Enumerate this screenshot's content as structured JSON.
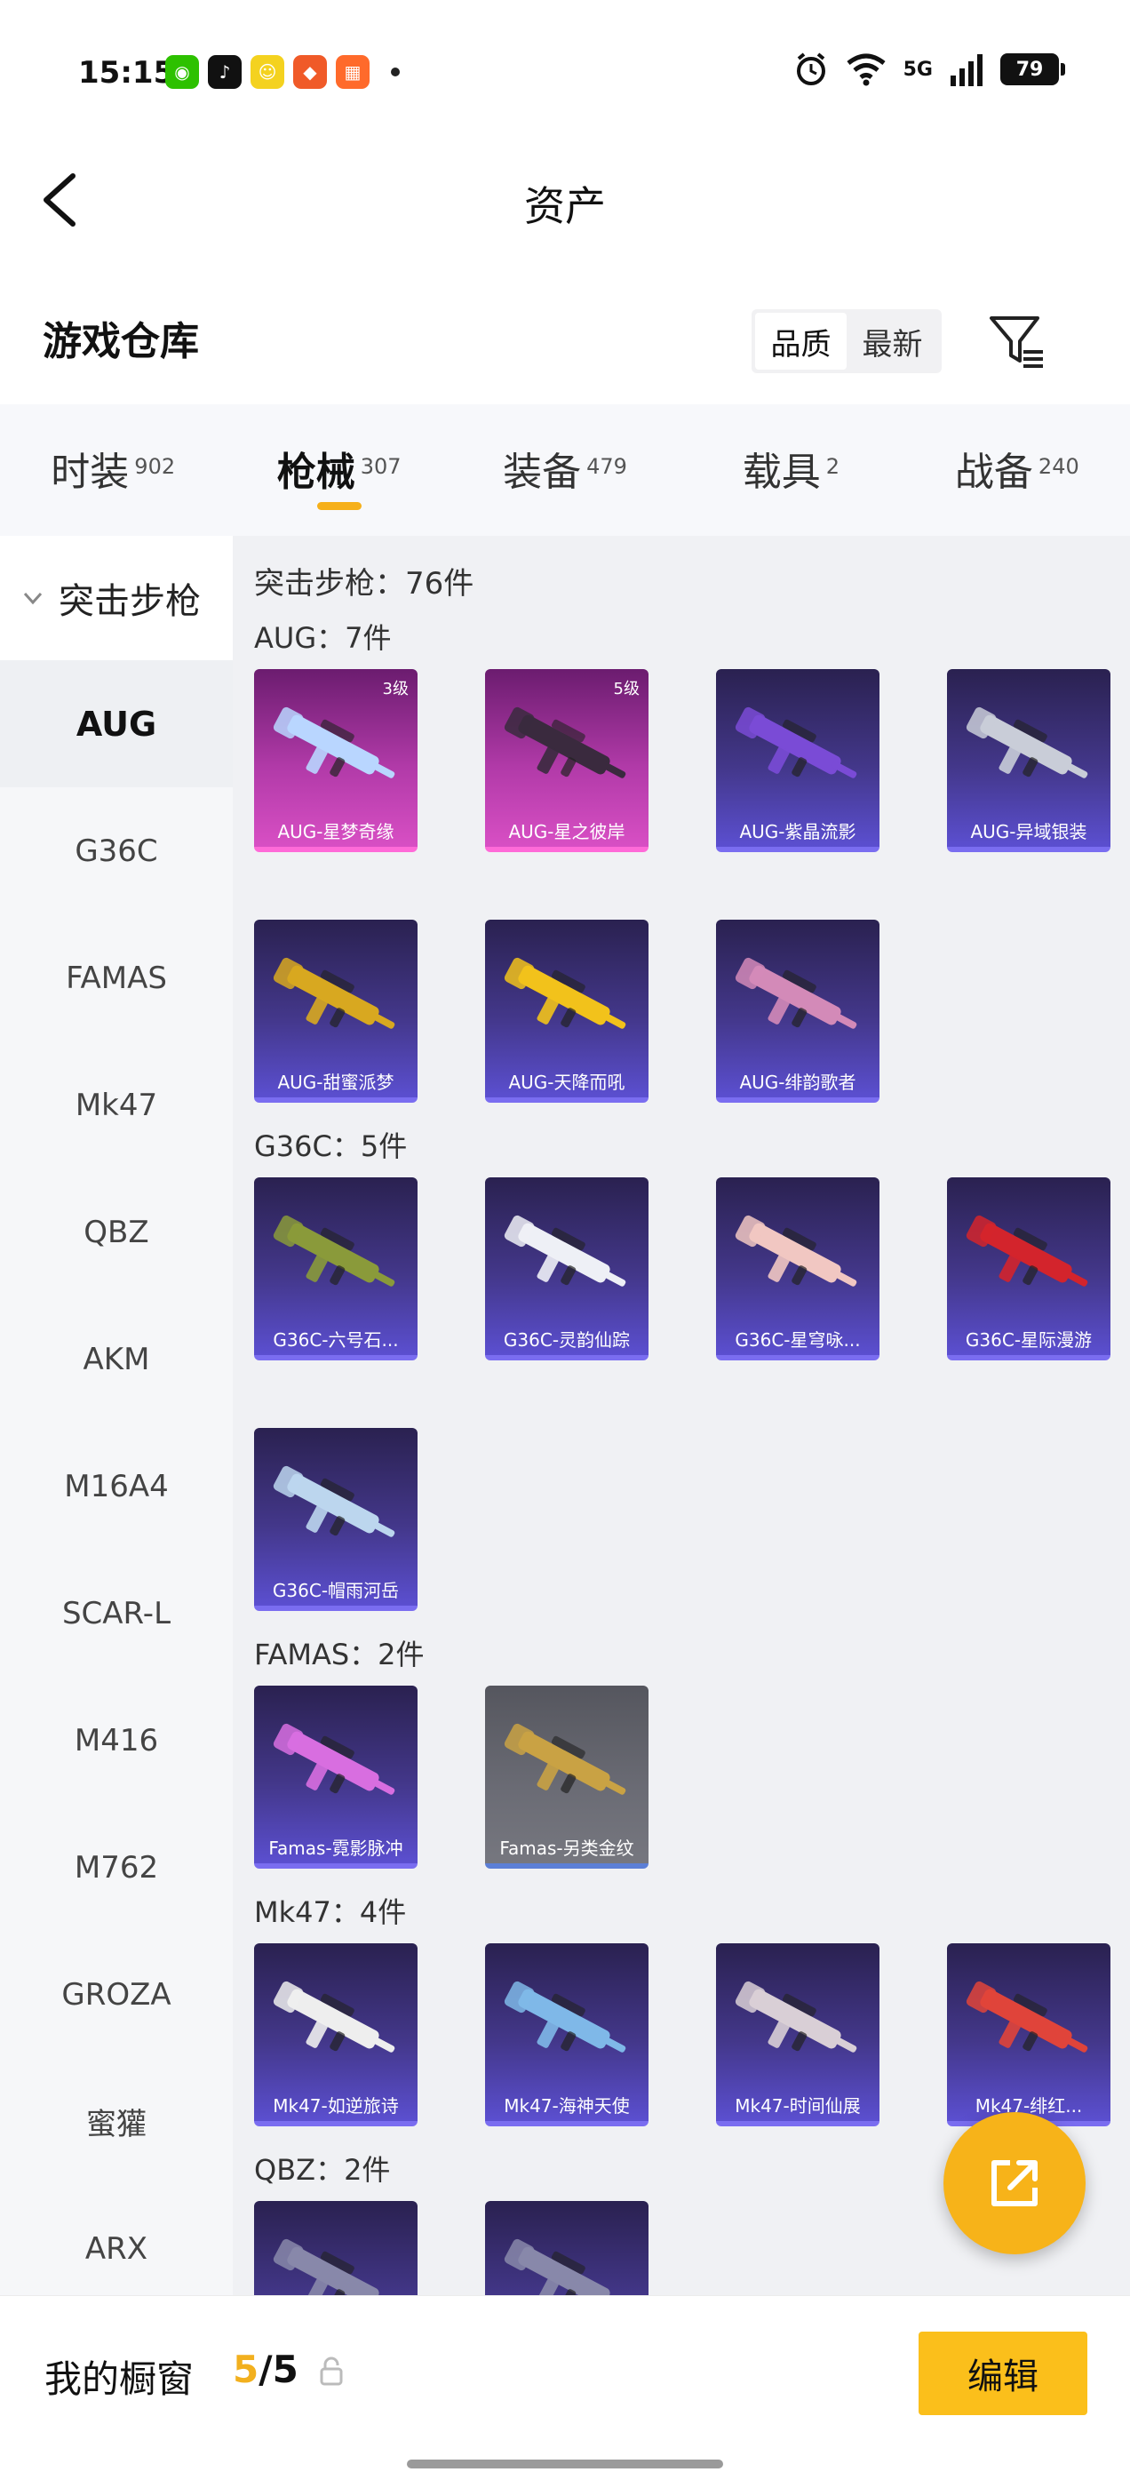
{
  "status_bar": {
    "time": "15:15",
    "apps": [
      {
        "icon": "wechat-icon",
        "color": "#2dc100",
        "glyph": "◉"
      },
      {
        "icon": "tiktok-icon",
        "color": "#111111",
        "glyph": "♪"
      },
      {
        "icon": "app-yellow-icon",
        "color": "#f4d21f",
        "glyph": "☺"
      },
      {
        "icon": "app-orange-icon",
        "color": "#f05a28",
        "glyph": "◆"
      },
      {
        "icon": "app-grid-icon",
        "color": "#ff6a2b",
        "glyph": "▦"
      }
    ],
    "network": "5G",
    "battery": "79"
  },
  "header": {
    "title": "资产"
  },
  "warehouse": {
    "title": "游戏仓库",
    "sort_options": [
      "品质",
      "最新"
    ],
    "active_sort": "品质"
  },
  "tabs": [
    {
      "label": "时装",
      "count": "902"
    },
    {
      "label": "枪械",
      "count": "307",
      "active": true
    },
    {
      "label": "装备",
      "count": "479"
    },
    {
      "label": "载具",
      "count": "2"
    },
    {
      "label": "战备",
      "count": "240"
    }
  ],
  "sidebar": {
    "category": "突击步枪",
    "items": [
      "AUG",
      "G36C",
      "FAMAS",
      "Mk47",
      "QBZ",
      "AKM",
      "M16A4",
      "SCAR-L",
      "M416",
      "M762",
      "GROZA",
      "蜜獾",
      "ARX"
    ],
    "active": "AUG"
  },
  "content": {
    "heading": "突击步枪：76件",
    "groups": [
      {
        "label": "AUG：7件",
        "items": [
          {
            "name": "AUG-星梦奇缘",
            "style": "pink",
            "level": "3级",
            "color": "#b9d6ff"
          },
          {
            "name": "AUG-星之彼岸",
            "style": "pink",
            "level": "5级",
            "color": "#3a2a3e"
          },
          {
            "name": "AUG-紫晶流影",
            "style": "purple",
            "color": "#7a4bd6"
          },
          {
            "name": "AUG-异域银装",
            "style": "purple",
            "color": "#c9cdd8"
          },
          {
            "name": "AUG-甜蜜派梦",
            "style": "purple",
            "color": "#d8a820"
          },
          {
            "name": "AUG-天降而吼",
            "style": "purple",
            "color": "#f2c21b"
          },
          {
            "name": "AUG-绯韵歌者",
            "style": "purple",
            "color": "#d38ab8"
          }
        ]
      },
      {
        "label": "G36C：5件",
        "items": [
          {
            "name": "G36C-六号石...",
            "style": "purple",
            "color": "#8a9a3a"
          },
          {
            "name": "G36C-灵韵仙踪",
            "style": "purple",
            "color": "#eef0f6"
          },
          {
            "name": "G36C-星穹咏...",
            "style": "purple",
            "color": "#f1c7c2"
          },
          {
            "name": "G36C-星际漫游",
            "style": "purple",
            "color": "#d3242c"
          },
          {
            "name": "G36C-帽雨河岳",
            "style": "purple",
            "color": "#bcd6ee"
          }
        ]
      },
      {
        "label": "FAMAS：2件",
        "items": [
          {
            "name": "Famas-霓影脉冲",
            "style": "purple",
            "color": "#d86ee0"
          },
          {
            "name": "Famas-另类金纹",
            "style": "gray",
            "color": "#c9a244"
          }
        ]
      },
      {
        "label": "Mk47：4件",
        "items": [
          {
            "name": "Mk47-如逆旅诗",
            "style": "purple",
            "color": "#eeeeee"
          },
          {
            "name": "Mk47-海神天使",
            "style": "purple",
            "color": "#7fb8e8"
          },
          {
            "name": "Mk47-时间仙展",
            "style": "purple",
            "color": "#d9cfd6"
          },
          {
            "name": "Mk47-绯红...",
            "style": "purple",
            "color": "#e0443a"
          }
        ]
      },
      {
        "label": "QBZ：2件",
        "items": [
          {
            "name": "",
            "style": "purple",
            "color": "#8888aa"
          },
          {
            "name": "",
            "style": "purple",
            "color": "#8888aa"
          }
        ]
      }
    ]
  },
  "bottom_bar": {
    "showcase_label": "我的橱窗",
    "showcase_current": "5",
    "showcase_total": "/5",
    "edit_label": "编辑"
  },
  "colors": {
    "accent": "#f6b01a",
    "card_purple": "#43378a",
    "card_pink": "#b13aa8"
  }
}
